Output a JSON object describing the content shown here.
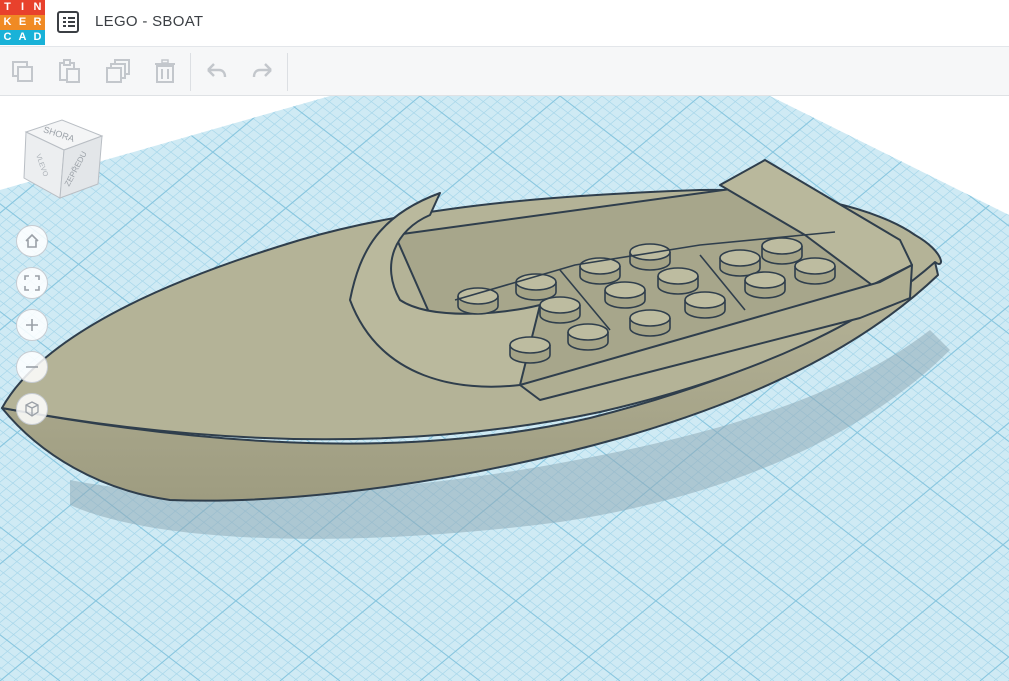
{
  "app": {
    "logo_letters": [
      "T",
      "I",
      "N",
      "K",
      "E",
      "R",
      "C",
      "A",
      "D"
    ],
    "logo_colors": [
      "#e8412c",
      "#e8412c",
      "#e8412c",
      "#f08a24",
      "#f08a24",
      "#f08a24",
      "#19b2d8",
      "#19b2d8",
      "#19b2d8"
    ],
    "project_title": "LEGO - SBOAT"
  },
  "toolbar": {
    "buttons": [
      {
        "name": "copy",
        "icon": "copy-icon",
        "enabled": false
      },
      {
        "name": "paste",
        "icon": "paste-icon",
        "enabled": false
      },
      {
        "name": "duplicate",
        "icon": "duplicate-icon",
        "enabled": false
      },
      {
        "name": "delete",
        "icon": "trash-icon",
        "enabled": false
      },
      {
        "name": "undo",
        "icon": "undo-arrow-icon",
        "enabled": false
      },
      {
        "name": "redo",
        "icon": "redo-arrow-icon",
        "enabled": false
      }
    ]
  },
  "viewcube": {
    "top_label": "SHORA",
    "front_label": "ZEPŘEDU",
    "left_label": "VLEVO"
  },
  "nav_controls": [
    {
      "name": "home-view",
      "icon": "home-icon"
    },
    {
      "name": "fit-view",
      "icon": "fit-frame-icon"
    },
    {
      "name": "zoom-in",
      "icon": "plus-icon"
    },
    {
      "name": "zoom-out",
      "icon": "minus-icon"
    },
    {
      "name": "projection",
      "icon": "cube-icon"
    }
  ],
  "colors": {
    "grid_bg": "#cfeaf4",
    "grid_line": "#9fd2e6",
    "model_fill": "#aaa98c",
    "model_edge": "#2f3e4c"
  }
}
